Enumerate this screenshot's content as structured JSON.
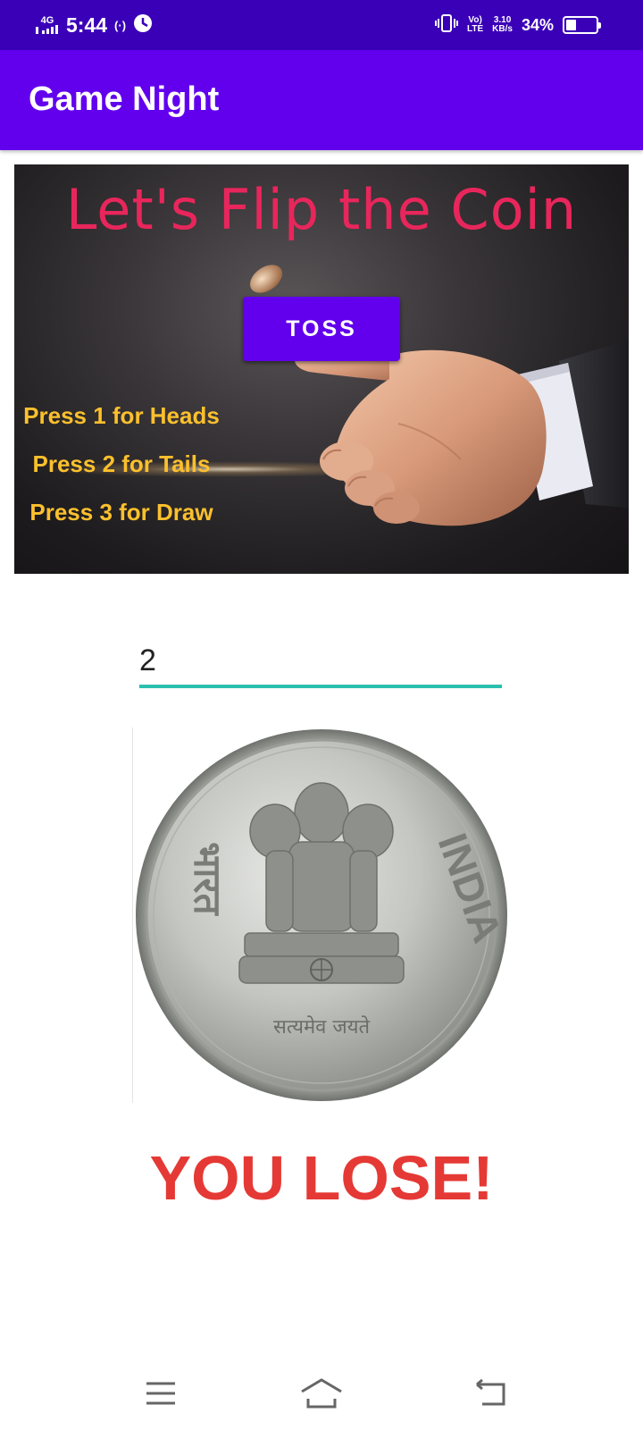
{
  "status_bar": {
    "network": "4G",
    "time": "5:44",
    "hotspot": "(·)",
    "volte_top": "Vo)",
    "volte_bottom": "LTE",
    "speed_value": "3.10",
    "speed_unit": "KB/s",
    "battery_percent_text": "34%",
    "battery_level": 0.34,
    "icons": [
      "signal-icon",
      "hotspot-icon",
      "data-saver-icon",
      "vibrate-icon",
      "battery-icon"
    ]
  },
  "app_bar": {
    "title": "Game Night"
  },
  "banner": {
    "title": "Let's Flip the Coin",
    "toss_label": "TOSS",
    "instructions": [
      "Press 1 for Heads",
      "Press 2 for Tails",
      "Press 3 for Draw"
    ]
  },
  "guess_input": {
    "value": "2"
  },
  "coin": {
    "text_left": "भारत",
    "text_right": "INDIA",
    "motto": "सत्यमेव जयते"
  },
  "result": {
    "text": "YOU LOSE!",
    "color": "#e53935"
  },
  "colors": {
    "status_bar": "#3a00b8",
    "primary": "#6200ee",
    "accent": "#2bbfae",
    "instruction_text": "#fbc02d",
    "banner_title": "#e8265c"
  },
  "nav_bar": {
    "icons": [
      "menu-icon",
      "home-icon",
      "back-icon"
    ]
  }
}
